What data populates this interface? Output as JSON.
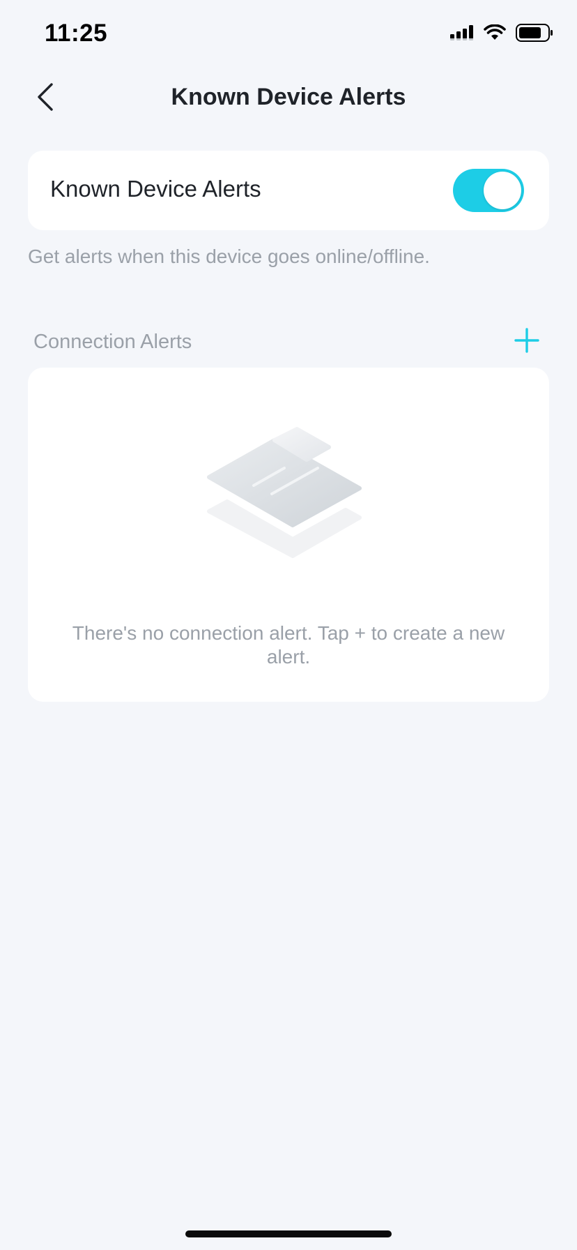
{
  "status_bar": {
    "time": "11:25"
  },
  "nav": {
    "title": "Known Device Alerts",
    "back_icon": "chevron-left-icon"
  },
  "toggle_card": {
    "label": "Known Device Alerts",
    "enabled": true,
    "accent_color": "#1dcde6"
  },
  "hint": "Get alerts when this device goes online/offline.",
  "connection_alerts": {
    "title": "Connection Alerts",
    "add_icon": "plus-icon",
    "empty_text": "There's no connection alert. Tap + to create a new alert."
  }
}
